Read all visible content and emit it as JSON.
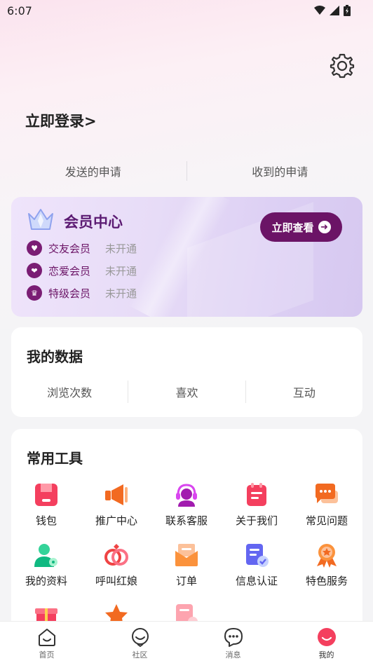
{
  "status_bar": {
    "time": "6:07"
  },
  "header": {
    "login_text": "立即登录>"
  },
  "applications": {
    "sent": "发送的申请",
    "received": "收到的申请"
  },
  "vip": {
    "title": "会员中心",
    "button_label": "立即查看",
    "items": [
      {
        "name": "交友会员",
        "state": "未开通"
      },
      {
        "name": "恋爱会员",
        "state": "未开通"
      },
      {
        "name": "特级会员",
        "state": "未开通"
      }
    ]
  },
  "my_data": {
    "title": "我的数据",
    "items": [
      "浏览次数",
      "喜欢",
      "互动"
    ]
  },
  "tools": {
    "title": "常用工具",
    "items": [
      {
        "label": "钱包",
        "icon": "wallet-icon"
      },
      {
        "label": "推广中心",
        "icon": "megaphone-icon"
      },
      {
        "label": "联系客服",
        "icon": "customer-service-icon"
      },
      {
        "label": "关于我们",
        "icon": "clipboard-icon"
      },
      {
        "label": "常见问题",
        "icon": "chat-bubbles-icon"
      },
      {
        "label": "我的资料",
        "icon": "profile-icon"
      },
      {
        "label": "呼叫红娘",
        "icon": "rings-icon"
      },
      {
        "label": "订单",
        "icon": "envelope-icon"
      },
      {
        "label": "信息认证",
        "icon": "verified-document-icon"
      },
      {
        "label": "特色服务",
        "icon": "medal-icon"
      },
      {
        "label": "",
        "icon": "gift-icon"
      },
      {
        "label": "",
        "icon": "star-icon"
      },
      {
        "label": "",
        "icon": "edit-document-icon"
      }
    ]
  },
  "tab_bar": {
    "items": [
      {
        "label": "首页",
        "icon": "home-icon"
      },
      {
        "label": "社区",
        "icon": "community-icon"
      },
      {
        "label": "消息",
        "icon": "message-icon"
      },
      {
        "label": "我的",
        "icon": "me-icon"
      }
    ]
  },
  "colors": {
    "accent": "#6b1466",
    "tab_active": "#f43f5e"
  }
}
